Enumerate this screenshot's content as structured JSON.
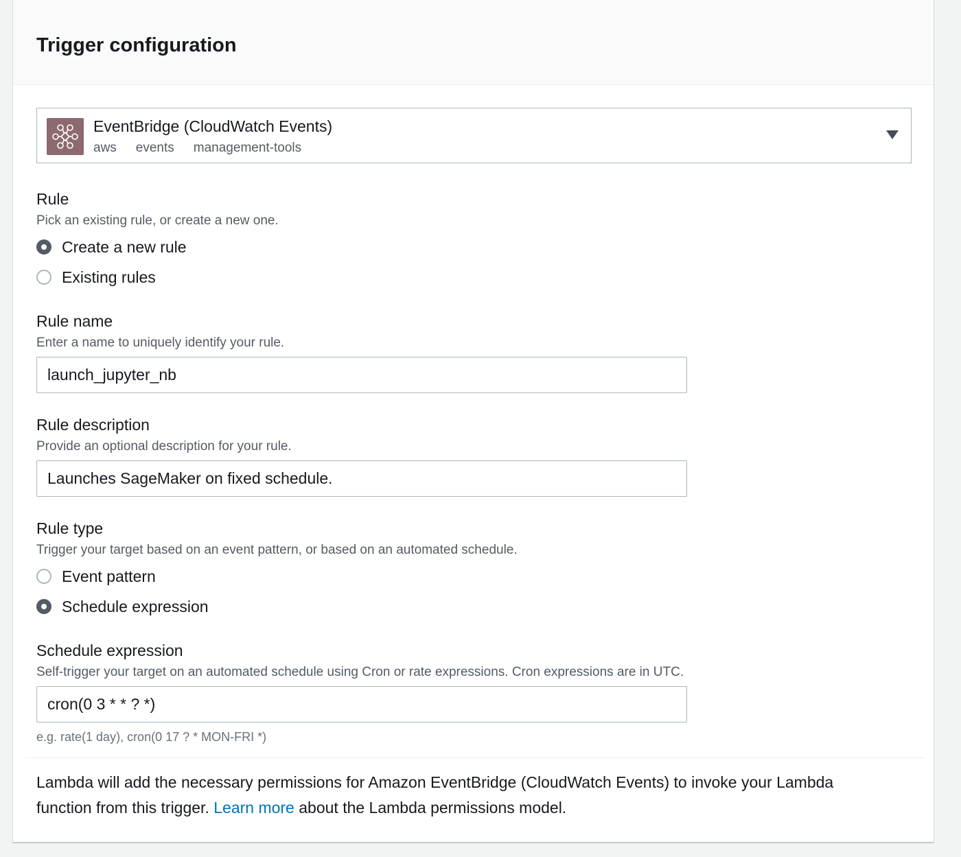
{
  "panel": {
    "title": "Trigger configuration"
  },
  "service": {
    "name": "EventBridge (CloudWatch Events)",
    "tags": [
      "aws",
      "events",
      "management-tools"
    ],
    "icon": "eventbridge-icon",
    "icon_color": "#8c6a70"
  },
  "rule": {
    "label": "Rule",
    "description": "Pick an existing rule, or create a new one.",
    "options": [
      {
        "label": "Create a new rule",
        "checked": true
      },
      {
        "label": "Existing rules",
        "checked": false
      }
    ]
  },
  "rule_name": {
    "label": "Rule name",
    "description": "Enter a name to uniquely identify your rule.",
    "value": "launch_jupyter_nb"
  },
  "rule_description": {
    "label": "Rule description",
    "description": "Provide an optional description for your rule.",
    "value": "Launches SageMaker on fixed schedule."
  },
  "rule_type": {
    "label": "Rule type",
    "description": "Trigger your target based on an event pattern, or based on an automated schedule.",
    "options": [
      {
        "label": "Event pattern",
        "checked": false
      },
      {
        "label": "Schedule expression",
        "checked": true
      }
    ]
  },
  "schedule_expression": {
    "label": "Schedule expression",
    "description": "Self-trigger your target on an automated schedule using Cron or rate expressions. Cron expressions are in UTC.",
    "value": "cron(0 3 * * ? *)",
    "hint": "e.g. rate(1 day), cron(0 17 ? * MON-FRI *)"
  },
  "permissions_note": {
    "before": "Lambda will add the necessary permissions for Amazon EventBridge (CloudWatch Events) to invoke your Lambda function from this trigger. ",
    "link": "Learn more",
    "after": " about the Lambda permissions model."
  },
  "colors": {
    "link": "#0073bb",
    "radio_checked": "#545b64",
    "border": "#aab7b8"
  }
}
